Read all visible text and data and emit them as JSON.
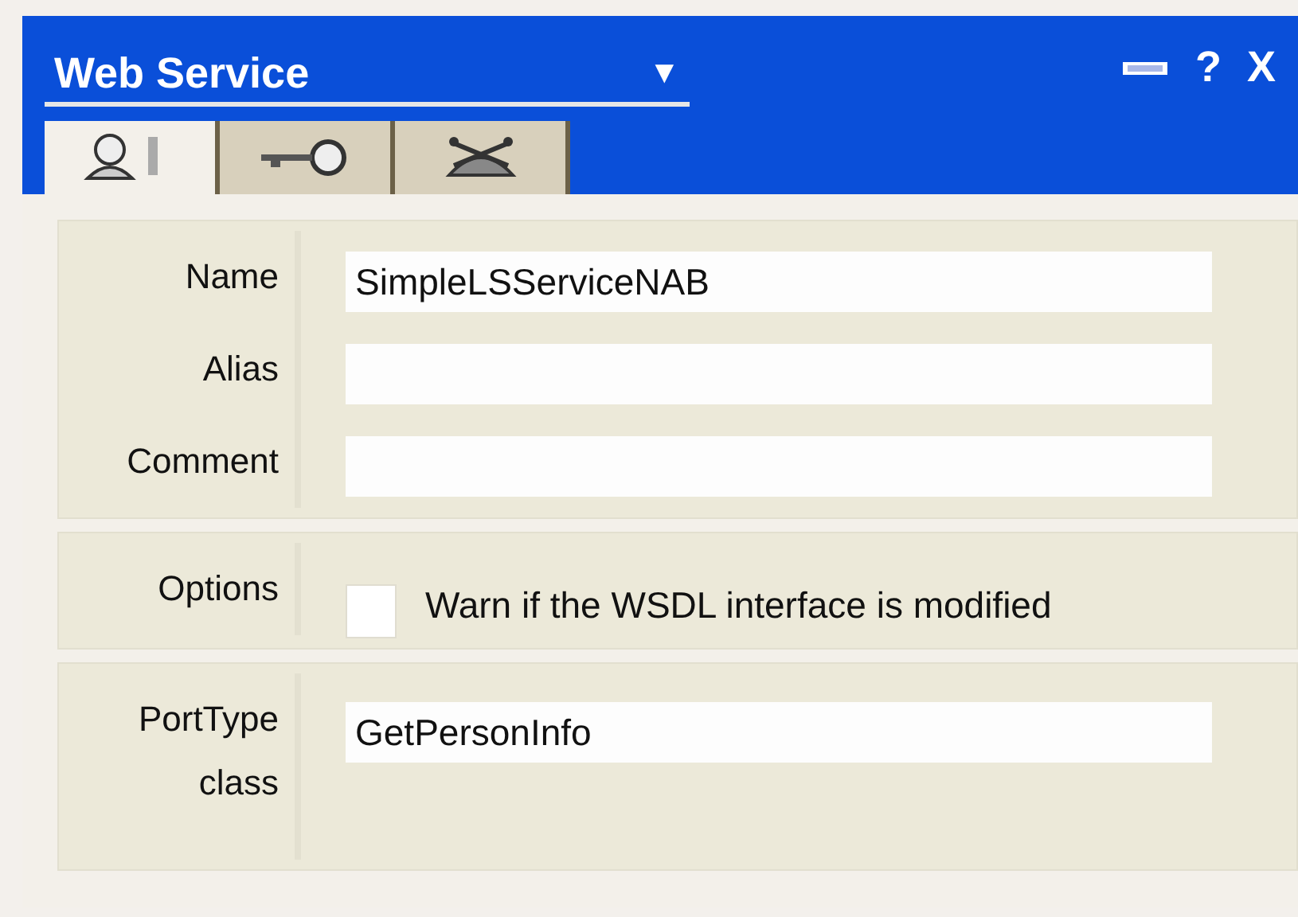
{
  "window": {
    "title": "Web Service",
    "dropdown": "▼",
    "controls": [
      {
        "kind": "pin"
      },
      {
        "kind": "help",
        "label": "?"
      },
      {
        "kind": "close",
        "label": "X"
      }
    ]
  },
  "tabs": [
    {
      "kind": "general",
      "selected": true
    },
    {
      "kind": "security",
      "selected": false
    },
    {
      "kind": "server",
      "selected": false
    }
  ],
  "sections": [
    {
      "rows": [
        {
          "kind": "field",
          "label": "Name",
          "value": "SimpleLSServiceNAB"
        },
        {
          "kind": "field",
          "label": "Alias"
        },
        {
          "kind": "field",
          "label": "Comment"
        }
      ]
    },
    {
      "rows": [
        {
          "kind": "checkbox",
          "label": "Options",
          "text": "Warn if the WSDL interface is modified",
          "checked": false
        }
      ]
    },
    {
      "rows": [
        {
          "kind": "tallfield",
          "label": "PortType class",
          "value": "GetPersonInfo"
        }
      ]
    }
  ]
}
